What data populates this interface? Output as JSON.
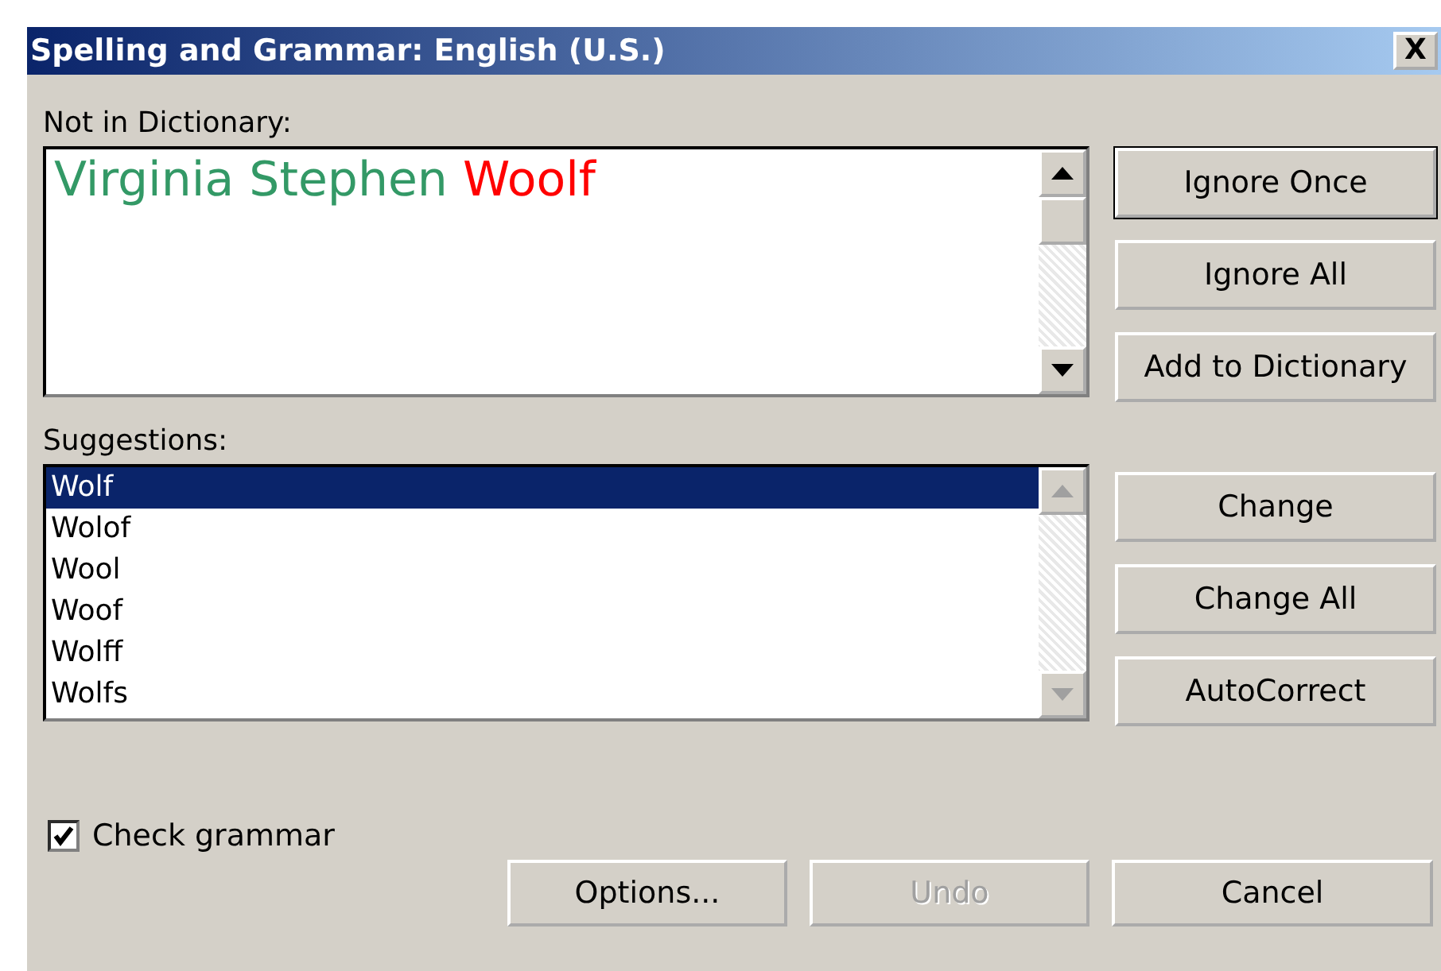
{
  "window": {
    "title": "Spelling and Grammar: English (U.S.)",
    "close": "X"
  },
  "not_in_dictionary": {
    "label": "Not in Dictionary:",
    "segments": [
      {
        "text": "Virginia Stephen ",
        "color": "#339966"
      },
      {
        "text": "Woolf",
        "color": "#ff0000"
      }
    ]
  },
  "top_buttons": [
    {
      "label": "Ignore Once",
      "disabled": false,
      "default": true
    },
    {
      "label": "Ignore All",
      "disabled": false,
      "default": false
    },
    {
      "label": "Add to Dictionary",
      "disabled": false,
      "default": false
    }
  ],
  "suggestions": {
    "label": "Suggestions:",
    "items": [
      {
        "text": "Wolf",
        "selected": true
      },
      {
        "text": "Wolof",
        "selected": false
      },
      {
        "text": "Wool",
        "selected": false
      },
      {
        "text": "Woof",
        "selected": false
      },
      {
        "text": "Wolff",
        "selected": false
      },
      {
        "text": "Wolfs",
        "selected": false
      }
    ]
  },
  "side_buttons": [
    {
      "label": "Change",
      "disabled": false
    },
    {
      "label": "Change All",
      "disabled": false
    },
    {
      "label": "AutoCorrect",
      "disabled": false
    }
  ],
  "check_grammar": {
    "label": "Check grammar",
    "checked": true
  },
  "bottom_buttons": [
    {
      "label": "Options...",
      "disabled": false
    },
    {
      "label": "Undo",
      "disabled": true
    },
    {
      "label": "Cancel",
      "disabled": false
    }
  ]
}
